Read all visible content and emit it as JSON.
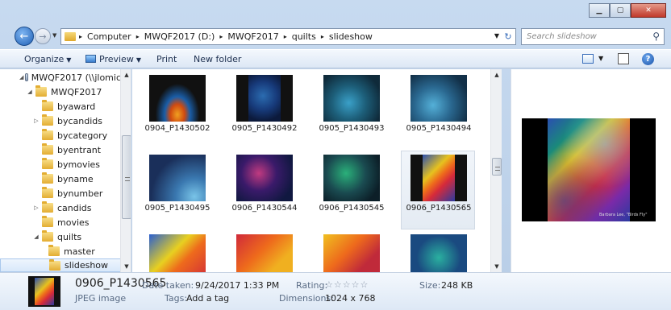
{
  "window": {
    "minimize_icon": "minimize-icon",
    "maximize_icon": "maximize-icon",
    "close_glyph": "✕"
  },
  "nav": {
    "back_glyph": "←",
    "forward_glyph": "→"
  },
  "address": {
    "segments": [
      "Computer",
      "MWQF2017 (D:)",
      "MWQF2017",
      "quilts",
      "slideshow"
    ],
    "separator": "▸"
  },
  "search": {
    "placeholder": "Search slideshow"
  },
  "toolbar": {
    "organize": "Organize",
    "preview": "Preview",
    "print": "Print",
    "new_folder": "New folder"
  },
  "tree": [
    {
      "label": "MWQF2017 (\\\\jlomic",
      "toggle": "◢",
      "type": "drive"
    },
    {
      "label": "MWQF2017",
      "toggle": "◢",
      "type": "folder"
    },
    {
      "label": "byaward",
      "toggle": "",
      "type": "folder"
    },
    {
      "label": "bycandids",
      "toggle": "▷",
      "type": "folder"
    },
    {
      "label": "bycategory",
      "toggle": "",
      "type": "folder"
    },
    {
      "label": "byentrant",
      "toggle": "",
      "type": "folder"
    },
    {
      "label": "bymovies",
      "toggle": "",
      "type": "folder"
    },
    {
      "label": "byname",
      "toggle": "",
      "type": "folder"
    },
    {
      "label": "bynumber",
      "toggle": "",
      "type": "folder"
    },
    {
      "label": "candids",
      "toggle": "▷",
      "type": "folder"
    },
    {
      "label": "movies",
      "toggle": "",
      "type": "folder"
    },
    {
      "label": "quilts",
      "toggle": "◢",
      "type": "folder"
    },
    {
      "label": "master",
      "toggle": "",
      "type": "folder"
    },
    {
      "label": "slideshow",
      "toggle": "",
      "type": "folder"
    }
  ],
  "files": [
    {
      "name": "0904_P1430502"
    },
    {
      "name": "0905_P1430492"
    },
    {
      "name": "0905_P1430493"
    },
    {
      "name": "0905_P1430494"
    },
    {
      "name": "0905_P1430495"
    },
    {
      "name": "0906_P1430544"
    },
    {
      "name": "0906_P1430545"
    },
    {
      "name": "0906_P1430565"
    },
    {
      "name": ""
    },
    {
      "name": ""
    },
    {
      "name": ""
    },
    {
      "name": ""
    }
  ],
  "preview_caption": "Barbara Lee, \"Birds Fly\"",
  "details": {
    "filename": "0906_P1430565",
    "filetype": "JPEG image",
    "date_label": "Date taken:",
    "date_value": "9/24/2017 1:33 PM",
    "tags_label": "Tags:",
    "tags_value": "Add a tag",
    "rating_label": "Rating:",
    "rating_stars": "☆☆☆☆☆",
    "dimensions_label": "Dimensions:",
    "dimensions_value": "1024 x 768",
    "size_label": "Size:",
    "size_value": "248 KB"
  },
  "colors": {
    "accent": "#1f5fb5",
    "selection": "#d8e8fa"
  }
}
